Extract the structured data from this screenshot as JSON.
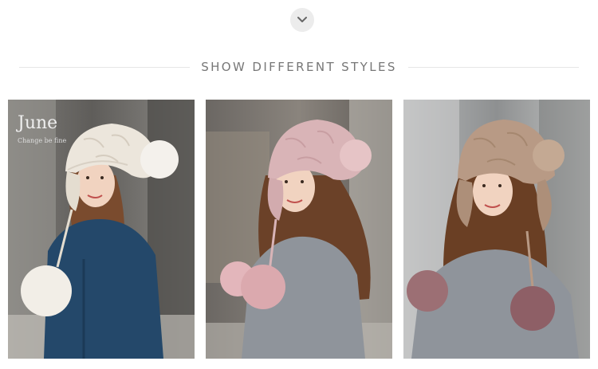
{
  "scroll_control": {
    "icon": "chevron-down-icon"
  },
  "section": {
    "title": "SHOW DIFFERENT STYLES"
  },
  "photos": [
    {
      "hat_color": "cream",
      "store_sign": "June",
      "store_sign_sub": "Change be fine"
    },
    {
      "hat_color": "pink"
    },
    {
      "hat_color": "khaki"
    }
  ],
  "colors": {
    "hat_cream": "#ece6dc",
    "hat_pink": "#d9b4b7",
    "hat_khaki": "#b89a85",
    "sweater_blue": "#24486a",
    "sweater_gray": "#8f949b"
  }
}
